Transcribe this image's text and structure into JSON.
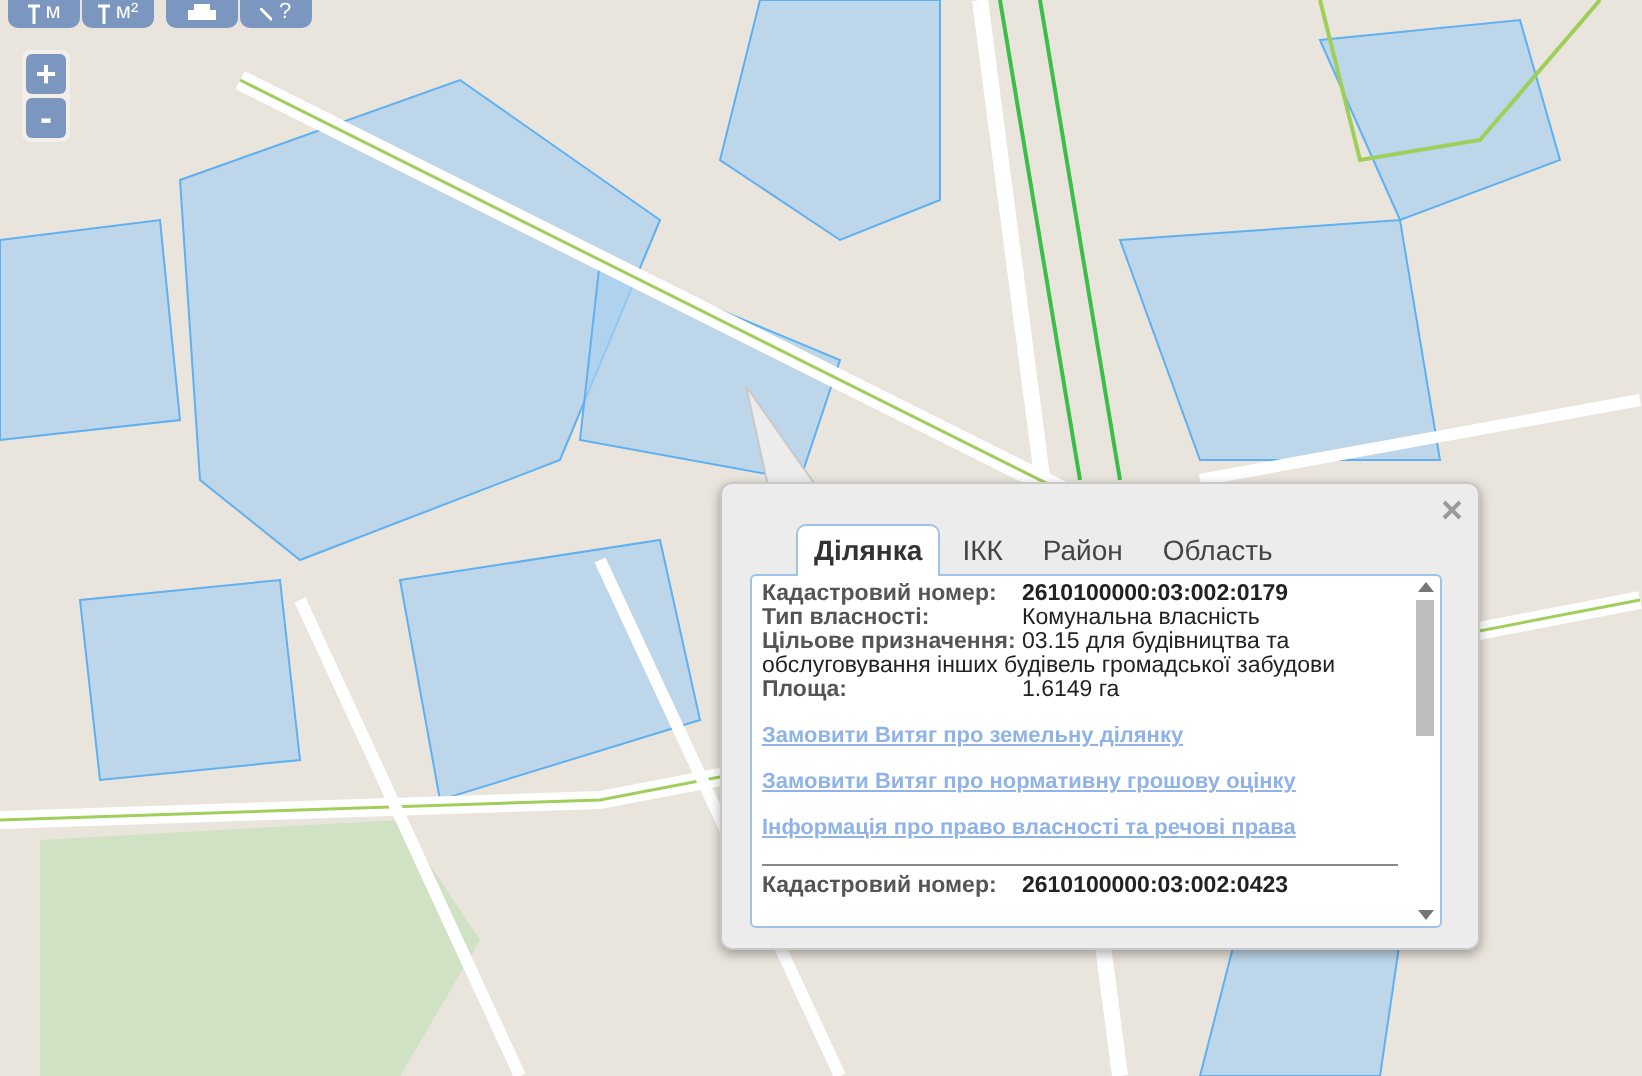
{
  "map_controls": {
    "toolbar": [
      {
        "kind": "length",
        "label": "м"
      },
      {
        "kind": "area",
        "label": "м²"
      },
      {
        "kind": "print"
      },
      {
        "kind": "help",
        "label": "?"
      }
    ],
    "zoom": [
      "+",
      "-"
    ]
  },
  "popup": {
    "tabs": [
      {
        "label": "Ділянка",
        "selected": true
      },
      {
        "label": "ІКК",
        "selected": false
      },
      {
        "label": "Район",
        "selected": false
      },
      {
        "label": "Область",
        "selected": false
      }
    ],
    "records": [
      {
        "fields": [
          {
            "kind": "number",
            "label": "Кадастровий номер:",
            "value": "2610100000:03:002:0179"
          },
          {
            "kind": "text",
            "label": "Тип власності:",
            "value": "Комунальна власність"
          },
          {
            "kind": "text",
            "label": "Цільове призначення:",
            "value": "03.15 для будівництва та обслуговування інших будівель громадської забудови"
          },
          {
            "kind": "text",
            "label": "Площа:",
            "value": "1.6149 га"
          }
        ],
        "links": [
          "Замовити Витяг про земельну ділянку",
          "Замовити Витяг про нормативну грошову оцінку",
          "Інформація про право власності та речові права"
        ]
      },
      {
        "fields": [
          {
            "kind": "number",
            "label": "Кадастровий номер:",
            "value": "2610100000:03:002:0423"
          }
        ]
      }
    ]
  }
}
